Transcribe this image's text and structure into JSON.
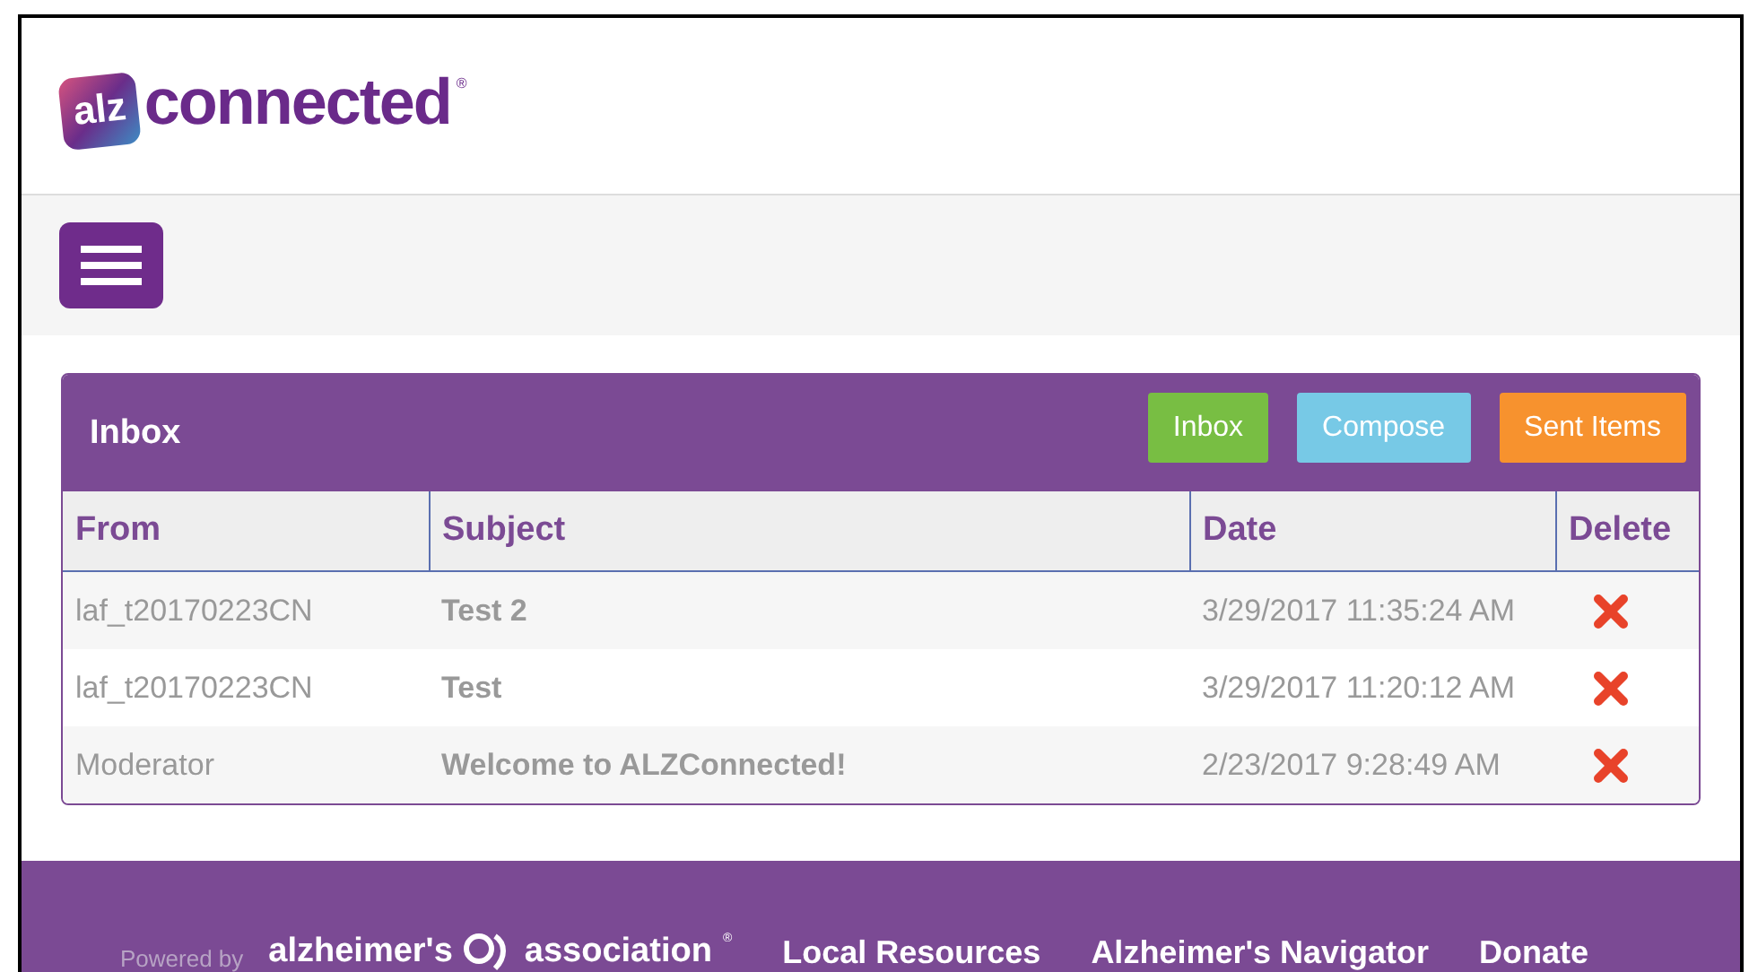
{
  "logo": {
    "badge": "alz",
    "wordmark": "connected",
    "mark": "®"
  },
  "panel": {
    "title": "Inbox",
    "buttons": [
      {
        "label": "Inbox",
        "kind": "inbox"
      },
      {
        "label": "Compose",
        "kind": "compose"
      },
      {
        "label": "Sent Items",
        "kind": "sent"
      }
    ]
  },
  "table": {
    "columns": [
      "From",
      "Subject",
      "Date",
      "Delete"
    ],
    "rows": [
      {
        "from": "laf_t20170223CN",
        "subject": "Test 2",
        "date": "3/29/2017 11:35:24 AM"
      },
      {
        "from": "laf_t20170223CN",
        "subject": "Test",
        "date": "3/29/2017 11:20:12 AM"
      },
      {
        "from": "Moderator",
        "subject": "Welcome to ALZConnected!",
        "date": "2/23/2017 9:28:49 AM"
      }
    ]
  },
  "footer": {
    "powered_by": "Powered by",
    "brand_left": "alzheimer's",
    "brand_right": "association",
    "brand_mark": "®",
    "links": [
      "Local Resources",
      "Alzheimer's Navigator",
      "Donate"
    ]
  }
}
